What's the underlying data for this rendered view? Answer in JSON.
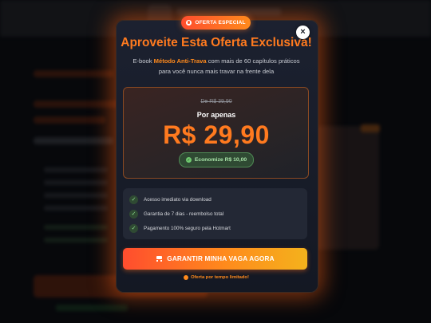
{
  "badge": {
    "label": "OFERTA ESPECIAL",
    "icon": "fire-icon"
  },
  "close": {
    "label": "×"
  },
  "title": "Aproveite Esta Oferta Exclusiva!",
  "subtitle": {
    "prefix": "E-book",
    "highlight": "Método Anti-Trava",
    "rest": "com mais de 60 capítulos práticos",
    "line2": "para você nunca mais travar na frente dela"
  },
  "pricing": {
    "old_price": "De R$ 39,90",
    "label": "Por apenas",
    "price": "R$ 29,90",
    "savings": "Economize R$ 10,00"
  },
  "benefits": [
    {
      "label": "Acesso imediato via download",
      "icon": "check-icon"
    },
    {
      "label": "Garantia de 7 dias - reembolso total",
      "icon": "check-icon"
    },
    {
      "label": "Pagamento 100% seguro pela Hotmart",
      "icon": "check-icon"
    }
  ],
  "cta": {
    "label": "GARANTIR MINHA VAGA AGORA",
    "icon": "cart-icon"
  },
  "footer_note": "Oferta por tempo limitado!",
  "colors": {
    "accent": "#ff7a1f",
    "accent_red": "#ff4d2e",
    "accent_yellow": "#f4b21c",
    "success": "#6fc96f",
    "modal_bg": "#1c2130"
  }
}
